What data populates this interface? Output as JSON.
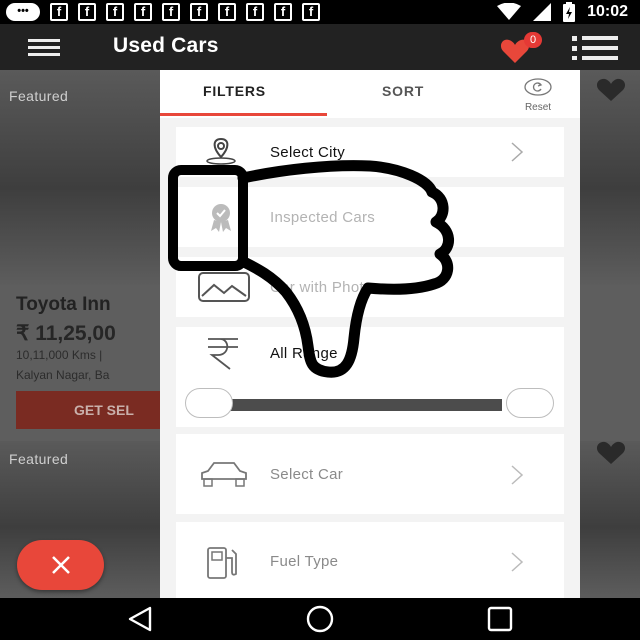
{
  "status_bar": {
    "notification_icons": [
      "messages-icon",
      "facebook-icon",
      "facebook-icon",
      "facebook-icon",
      "facebook-icon",
      "facebook-icon",
      "facebook-icon",
      "facebook-icon",
      "facebook-icon",
      "facebook-icon",
      "facebook-icon"
    ],
    "facebook_glyph": "f",
    "messages_glyph": "•••",
    "time": "10:02"
  },
  "app_bar": {
    "title": "Used Cars",
    "shortlist_count": "0"
  },
  "listing": {
    "cards": [
      {
        "badge": "Featured",
        "name": "Toyota Inn",
        "price": "₹ 11,25,00",
        "kms": "10,11,000 Kms  |",
        "location": "Kalyan Nagar, Ba",
        "cta": "GET SEL"
      },
      {
        "badge": "Featured"
      }
    ]
  },
  "filter_panel": {
    "tabs": [
      {
        "label": "FILTERS",
        "active": true
      },
      {
        "label": "SORT",
        "active": false
      }
    ],
    "reset_label": "Reset",
    "rows": [
      {
        "icon": "location-pin-icon",
        "label": "Select City"
      },
      {
        "icon": "badge-ribbon-icon",
        "label": "Inspected Cars"
      },
      {
        "icon": "image-icon",
        "label": "Car with Photo"
      },
      {
        "icon": "rupee-icon",
        "label": "All Range"
      },
      {
        "icon": "car-icon",
        "label": "Select Car"
      },
      {
        "icon": "fuel-pump-icon",
        "label": "Fuel Type"
      }
    ],
    "price_range": {
      "min_fraction": 0,
      "max_fraction": 1
    }
  },
  "overlay": {
    "icon": "thumbs-down-icon"
  },
  "nav_bar": {
    "icons": [
      "back-icon",
      "home-icon",
      "recents-icon"
    ]
  },
  "colors": {
    "accent": "#e8473a",
    "app_bar": "#222222",
    "panel_bg": "#f3f3f3"
  }
}
